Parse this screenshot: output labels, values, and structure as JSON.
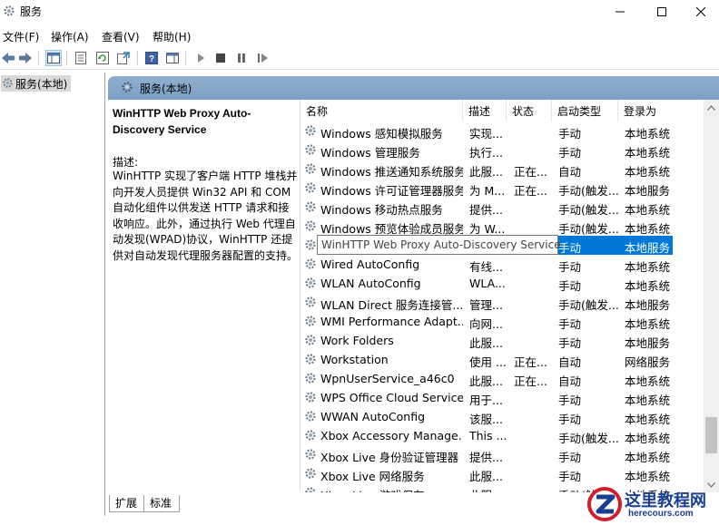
{
  "window": {
    "title": "服务"
  },
  "menu": [
    "文件(F)",
    "操作(A)",
    "查看(V)",
    "帮助(H)"
  ],
  "tree": {
    "item": "服务(本地)"
  },
  "right_header": {
    "label": "服务(本地)"
  },
  "description": {
    "service_name": "WinHTTP Web Proxy Auto-Discovery Service",
    "label": "描述:",
    "text": "WinHTTP 实现了客户端 HTTP 堆栈并向开发人员提供 Win32 API 和 COM 自动化组件以供发送 HTTP 请求和接收响应。此外，通过执行 Web 代理自动发现(WPAD)协议，WinHTTP 还提供对自动发现代理服务器配置的支持。"
  },
  "columns": [
    "名称",
    "描述",
    "状态",
    "启动类型",
    "登录为"
  ],
  "rows": [
    {
      "name": "Windows 感知模拟服务",
      "desc": "实现...",
      "status": "",
      "startup": "手动",
      "logon": "本地系统"
    },
    {
      "name": "Windows 管理服务",
      "desc": "执行...",
      "status": "",
      "startup": "手动",
      "logon": "本地系统"
    },
    {
      "name": "Windows 推送通知系统服务",
      "desc": "此服...",
      "status": "正在...",
      "startup": "自动",
      "logon": "本地系统"
    },
    {
      "name": "Windows 许可证管理器服务",
      "desc": "为 M...",
      "status": "正在...",
      "startup": "手动(触发...",
      "logon": "本地服务"
    },
    {
      "name": "Windows 移动热点服务",
      "desc": "提供...",
      "status": "",
      "startup": "手动(触发...",
      "logon": "本地系统"
    },
    {
      "name": "Windows 预览体验成员服务",
      "desc": "为 W...",
      "status": "",
      "startup": "手动(触发...",
      "logon": "本地系统"
    },
    {
      "name": "WinHTTP Web Proxy Auto-Discovery Service",
      "desc": "",
      "status": "",
      "startup": "手动",
      "logon": "本地服务",
      "selected": true
    },
    {
      "name": "Wired AutoConfig",
      "desc": "有线...",
      "status": "",
      "startup": "手动",
      "logon": "本地系统"
    },
    {
      "name": "WLAN AutoConfig",
      "desc": "WLA...",
      "status": "",
      "startup": "手动",
      "logon": "本地系统"
    },
    {
      "name": "WLAN Direct 服务连接管...",
      "desc": "管理...",
      "status": "",
      "startup": "手动(触发...",
      "logon": "本地服务"
    },
    {
      "name": "WMI Performance Adapt...",
      "desc": "向网...",
      "status": "",
      "startup": "手动",
      "logon": "本地系统"
    },
    {
      "name": "Work Folders",
      "desc": "此服...",
      "status": "",
      "startup": "手动",
      "logon": "本地服务"
    },
    {
      "name": "Workstation",
      "desc": "使用 ...",
      "status": "正在...",
      "startup": "自动",
      "logon": "网络服务"
    },
    {
      "name": "WpnUserService_a46c0",
      "desc": "此服...",
      "status": "正在...",
      "startup": "自动",
      "logon": "本地系统"
    },
    {
      "name": "WPS Office Cloud Service",
      "desc": "用于...",
      "status": "",
      "startup": "手动",
      "logon": "本地系统"
    },
    {
      "name": "WWAN AutoConfig",
      "desc": "该服...",
      "status": "",
      "startup": "手动",
      "logon": "本地系统"
    },
    {
      "name": "Xbox Accessory Manage...",
      "desc": "This ...",
      "status": "",
      "startup": "手动(触发...",
      "logon": "本地系统"
    },
    {
      "name": "Xbox Live 身份验证管理器",
      "desc": "提供...",
      "status": "",
      "startup": "手动",
      "logon": "本地系统"
    },
    {
      "name": "Xbox Live 网络服务",
      "desc": "此服...",
      "status": "",
      "startup": "手动",
      "logon": "本地系统"
    },
    {
      "name": "Xbox Live 游戏保存",
      "desc": "此服...",
      "status": "",
      "startup": "手动(触发...",
      "logon": "本地系统"
    }
  ],
  "tooltip": "WinHTTP Web Proxy Auto-Discovery Service",
  "tabs": [
    "扩展",
    "标准"
  ],
  "watermark": {
    "name": "这里教程网",
    "url": "herecours.com"
  },
  "colors": {
    "selection": "#0078d7",
    "header_blue": "#8fb0cf"
  }
}
